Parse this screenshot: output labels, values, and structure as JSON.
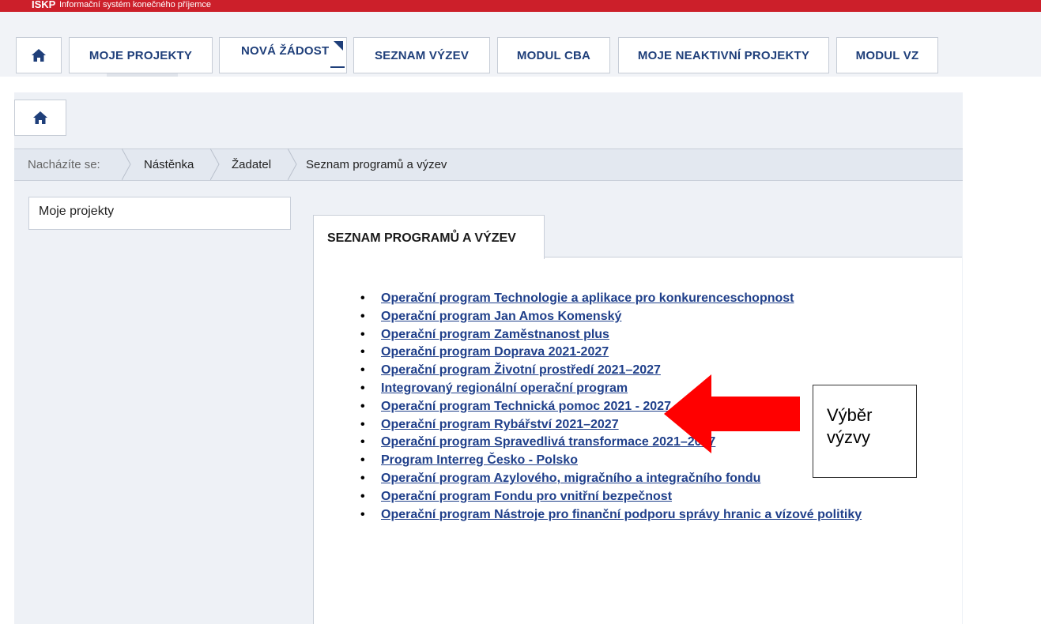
{
  "header": {
    "brand": "ISKP",
    "subtitle": "Informační systém konečného příjemce"
  },
  "topnav": {
    "home_icon": "home-icon",
    "items": [
      {
        "label": "MOJE PROJEKTY"
      },
      {
        "label": "NOVÁ ŽÁDOST"
      },
      {
        "label": "SEZNAM VÝZEV"
      },
      {
        "label": "MODUL CBA"
      },
      {
        "label": "MOJE NEAKTIVNÍ PROJEKTY"
      },
      {
        "label": "MODUL VZ"
      }
    ]
  },
  "breadcrumb": {
    "prefix": "Nacházíte se:",
    "items": [
      "Nástěnka",
      "Žadatel",
      "Seznam programů a výzev"
    ]
  },
  "sidebar": {
    "items": [
      {
        "label": "Moje projekty"
      }
    ]
  },
  "main": {
    "tab_label": "SEZNAM PROGRAMŮ A VÝZEV",
    "programs": [
      "Operační program Technologie a aplikace pro konkurenceschopnost",
      "Operační program Jan Amos Komenský",
      "Operační program Zaměstnanost plus",
      "Operační program Doprava 2021-2027",
      "Operační program Životní prostředí 2021–2027",
      "Integrovaný regionální operační program",
      "Operační program Technická pomoc 2021 - 2027",
      "Operační program Rybářství 2021–2027",
      "Operační program Spravedlivá transformace 2021–2027",
      "Program Interreg Česko - Polsko",
      "Operační program Azylového, migračního a integračního fondu",
      "Operační program Fondu pro vnitřní bezpečnost",
      "Operační program Nástroje pro finanční podporu správy hranic a vízové politiky"
    ]
  },
  "annotation": {
    "line1": "Výběr",
    "line2": "výzvy",
    "arrow_color": "#ff0000"
  }
}
